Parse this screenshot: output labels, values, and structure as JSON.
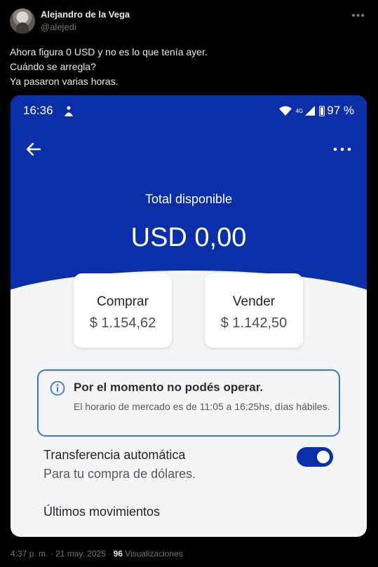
{
  "tweet": {
    "author_name": "Alejandro de la Vega",
    "author_handle": "@alejedi",
    "text_lines": [
      "Ahora figura 0 USD y no es lo que tenía ayer.",
      "Cuándo se arregla?",
      "Ya pasaron varias horas."
    ],
    "time": "4:37 p. m.",
    "date": "21 may. 2025",
    "views_count": "96",
    "views_label": "Visualizaciones"
  },
  "screenshot": {
    "status": {
      "time": "16:36",
      "network": "4G",
      "battery": "97 %"
    },
    "total_label": "Total disponible",
    "total_value": "USD 0,00",
    "buy": {
      "label": "Comprar",
      "value": "$ 1.154,62"
    },
    "sell": {
      "label": "Vender",
      "value": "$ 1.142,50"
    },
    "notice": {
      "title": "Por el momento no podés operar.",
      "body": "El horario de mercado es de 11:05 a 16:25hs, días hábiles."
    },
    "auto_transfer": {
      "title": "Transferencia automática",
      "subtitle": "Para tu compra de dólares.",
      "enabled": true
    },
    "movements_title": "Últimos movimientos",
    "colors": {
      "brand_blue": "#0a2fa9",
      "notice_border": "#3a72d8",
      "page_bg": "#000000"
    }
  }
}
